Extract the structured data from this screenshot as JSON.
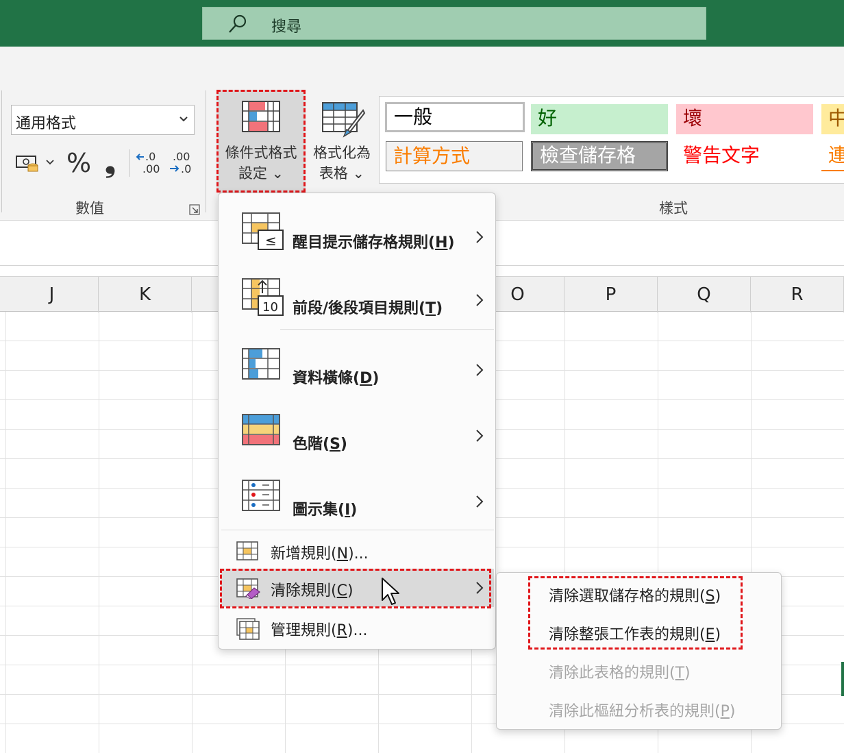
{
  "search": {
    "placeholder": "搜尋"
  },
  "number_group": {
    "format_value": "通用格式",
    "percent_symbol": "%",
    "comma_symbol": "❟",
    "inc_decimal": "←.0 .00",
    "dec_decimal": ".00 →.0",
    "label": "數值"
  },
  "conditional_formatting": {
    "line1": "條件式格式",
    "line2": "設定 ⌄"
  },
  "format_as_table": {
    "line1": "格式化為",
    "line2": "表格 ⌄"
  },
  "styles_group": {
    "label": "樣式",
    "cells": [
      {
        "text": "一般",
        "bg": "#ffffff",
        "fg": "#000000"
      },
      {
        "text": "好",
        "bg": "#c6efce",
        "fg": "#006100"
      },
      {
        "text": "壞",
        "bg": "#ffc7ce",
        "fg": "#9c0006"
      },
      {
        "text": "中",
        "bg": "#ffeb9c",
        "fg": "#9c5700"
      },
      {
        "text": "計算方式",
        "bg": "#f2f2f2",
        "fg": "#fa7d00"
      },
      {
        "text": "檢查儲存格",
        "bg": "#a5a5a5",
        "fg": "#ffffff"
      },
      {
        "text": "警告文字",
        "bg": "#ffffff",
        "fg": "#ff0000"
      },
      {
        "text": "連",
        "bg": "#ffffff",
        "fg": "#fa7d00"
      }
    ]
  },
  "columns": [
    "J",
    "K",
    "",
    "",
    "",
    "O",
    "P",
    "Q",
    "R"
  ],
  "cf_menu": {
    "highlight_rules": {
      "text": "醒目提示儲存格規則(",
      "key": "H",
      "end": ")"
    },
    "top_bottom_rules": {
      "text": "前段/後段項目規則(",
      "key": "T",
      "end": ")"
    },
    "top_bottom_icon_number": "10",
    "top_bottom_icon_sign": "≤",
    "data_bars": {
      "text": "資料橫條(",
      "key": "D",
      "end": ")"
    },
    "color_scales": {
      "text": "色階(",
      "key": "S",
      "end": ")"
    },
    "icon_sets": {
      "text": "圖示集(",
      "key": "I",
      "end": ")"
    },
    "new_rule": {
      "text": "新增規則(",
      "key": "N",
      "end": ")..."
    },
    "clear_rules": {
      "text": "清除規則(",
      "key": "C",
      "end": ")"
    },
    "manage_rules": {
      "text": "管理規則(",
      "key": "R",
      "end": ")..."
    }
  },
  "clear_submenu": {
    "selected_cells": {
      "text": "清除選取儲存格的規則(",
      "key": "S",
      "end": ")",
      "enabled": true
    },
    "entire_sheet": {
      "text": "清除整張工作表的規則(",
      "key": "E",
      "end": ")",
      "enabled": true
    },
    "this_table": {
      "text": "清除此表格的規則(",
      "key": "T",
      "end": ")",
      "enabled": false
    },
    "this_pivot": {
      "text": "清除此樞紐分析表的規則(",
      "key": "P",
      "end": ")",
      "enabled": false
    }
  },
  "colors": {
    "accent_green": "#217346",
    "highlight_dash": "#e0161a",
    "disabled_text": "#a6a6a6"
  }
}
